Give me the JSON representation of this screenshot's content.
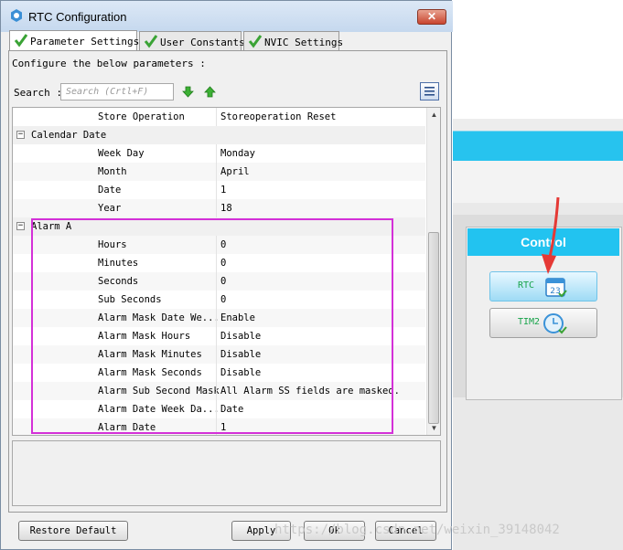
{
  "dialog": {
    "title": "RTC Configuration",
    "close_label": "✕",
    "tabs": [
      {
        "label": "Parameter Settings",
        "active": true
      },
      {
        "label": "User Constants",
        "active": false
      },
      {
        "label": "NVIC Settings",
        "active": false
      }
    ],
    "instructions": "Configure the below parameters :",
    "search": {
      "label": "Search :",
      "placeholder": "Search (Crtl+F)"
    },
    "rows": [
      {
        "type": "param",
        "name": "Store Operation",
        "value": "Storeoperation Reset"
      },
      {
        "type": "group",
        "name": "Calendar Date",
        "toggle": "−"
      },
      {
        "type": "param",
        "name": "Week Day",
        "value": "Monday"
      },
      {
        "type": "param",
        "name": "Month",
        "value": "April"
      },
      {
        "type": "param",
        "name": "Date",
        "value": "1"
      },
      {
        "type": "param",
        "name": "Year",
        "value": "18"
      },
      {
        "type": "group",
        "name": "Alarm A",
        "toggle": "−"
      },
      {
        "type": "param",
        "name": "Hours",
        "value": "0"
      },
      {
        "type": "param",
        "name": "Minutes",
        "value": "0"
      },
      {
        "type": "param",
        "name": "Seconds",
        "value": "0"
      },
      {
        "type": "param",
        "name": "Sub Seconds",
        "value": "0"
      },
      {
        "type": "param",
        "name": "Alarm Mask Date We...",
        "value": "Enable"
      },
      {
        "type": "param",
        "name": "Alarm Mask Hours",
        "value": "Disable"
      },
      {
        "type": "param",
        "name": "Alarm Mask Minutes",
        "value": "Disable"
      },
      {
        "type": "param",
        "name": "Alarm Mask Seconds",
        "value": "Disable"
      },
      {
        "type": "param",
        "name": "Alarm Sub Second Mask",
        "value": "All Alarm SS fields are masked."
      },
      {
        "type": "param",
        "name": "Alarm Date Week Da...",
        "value": "Date"
      },
      {
        "type": "param",
        "name": "Alarm Date",
        "value": "1"
      }
    ],
    "buttons": {
      "restore_default": "Restore Default",
      "apply": "Apply",
      "ok": "Ok",
      "cancel": "Cancel"
    }
  },
  "background_app": {
    "control_header": "Control",
    "rtc_button": "RTC",
    "tim2_button": "TIM2"
  },
  "watermark": "https://blog.csdn.net/weixin_39148042",
  "colors": {
    "highlight_box": "#d430d8",
    "accent_cyan": "#22c3f0",
    "annotation_arrow": "#e53935",
    "check_green": "#3aa335"
  }
}
